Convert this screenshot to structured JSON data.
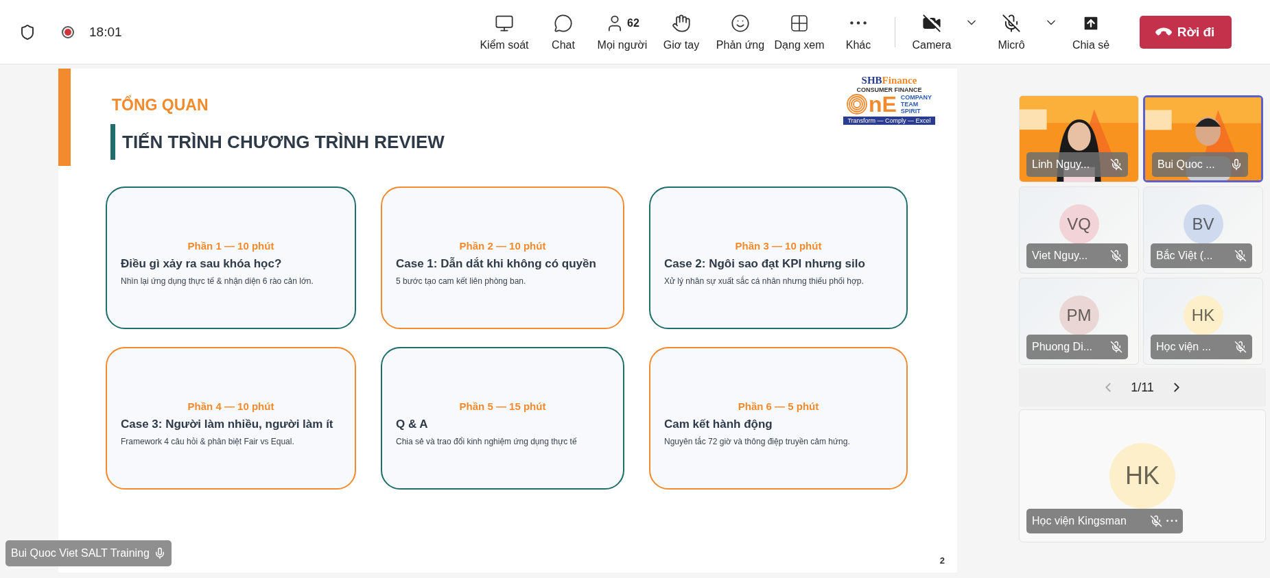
{
  "top_bar": {
    "time": "18:01",
    "recording": true
  },
  "toolbar": [
    {
      "label": "Kiểm soát"
    },
    {
      "label": "Chat"
    },
    {
      "label": "Mọi người",
      "badge": "62"
    },
    {
      "label": "Giơ tay"
    },
    {
      "label": "Phản ứng"
    },
    {
      "label": "Dạng xem"
    },
    {
      "label": "Khác"
    }
  ],
  "devices": [
    {
      "label": "Camera",
      "on": false
    },
    {
      "label": "Micrô",
      "on": false
    }
  ],
  "share": {
    "label": "Chia sẻ"
  },
  "leave_button": {
    "label": "Rời đi"
  },
  "slide": {
    "section": "TỔNG QUAN",
    "title": "TIẾN TRÌNH CHƯƠNG TRÌNH REVIEW",
    "page": "2",
    "logo": {
      "brand_prefix": "SHB",
      "brand_suffix": "Finance",
      "subtitle": "CONSUMER FINANCE",
      "letters": "nE",
      "words": [
        "COMPANY",
        "TEAM",
        "SPIRIT"
      ],
      "tagline": "Transform — Comply — Excel"
    },
    "cards": [
      {
        "label": "Phần 1 — 10 phút",
        "title": "Điều gì xảy ra sau khóa học?",
        "text": "Nhìn lại ứng dụng thực tế & nhận diện 6 rào cản lớn.",
        "color": "#1f6e6a"
      },
      {
        "label": "Phần 2 — 10 phút",
        "title": "Case 1: Dẫn dắt khi không có quyền",
        "text": "5 bước tạo cam kết liên phòng ban.",
        "color": "#f28a2e"
      },
      {
        "label": "Phần 3 — 10 phút",
        "title": "Case 2: Ngôi sao đạt KPI nhưng silo",
        "text": "Xử lý nhân sự xuất sắc cá nhân nhưng thiếu phối hợp.",
        "color": "#1f6e6a"
      },
      {
        "label": "Phần 4 — 10 phút",
        "title": "Case 3: Người làm nhiều, người làm ít",
        "text": "Framework 4 câu hỏi & phân biệt Fair vs Equal.",
        "color": "#f28a2e"
      },
      {
        "label": "Phần 5 — 15 phút",
        "title": "Q & A",
        "text": "Chia sẻ và trao đổi kinh nghiệm ứng dụng thực tế",
        "color": "#1f6e6a"
      },
      {
        "label": "Phần 6 — 5 phút",
        "title": "Cam kết hành động",
        "text": "Nguyên tắc 72 giờ và thông điệp truyền cảm hứng.",
        "color": "#f28a2e"
      }
    ]
  },
  "participants": [
    {
      "kind": "video",
      "name": "Linh Nguy...",
      "muted": true,
      "selected": false
    },
    {
      "kind": "video",
      "name": "Bui Quoc ...",
      "muted": false,
      "selected": true
    },
    {
      "kind": "avatar",
      "initials": "VQ",
      "name": "Viet Nguy...",
      "muted": true,
      "selected": false,
      "color": "#f2d3d7"
    },
    {
      "kind": "avatar",
      "initials": "BV",
      "name": "Bắc Việt (...",
      "muted": true,
      "selected": false,
      "color": "#cfdaee"
    },
    {
      "kind": "avatar",
      "initials": "PM",
      "name": "Phuong Di...",
      "muted": true,
      "selected": false,
      "color": "#ead7d5"
    },
    {
      "kind": "avatar",
      "initials": "HK",
      "name": "Học viện ...",
      "muted": true,
      "selected": false,
      "color": "#fcefca"
    }
  ],
  "pagination": {
    "label": "1/11",
    "prev_enabled": false
  },
  "self_tile": {
    "initials": "HK",
    "name": "Học viện Kingsman",
    "muted": true,
    "color": "#fcefca"
  },
  "speaker_label": {
    "name": "Bui Quoc Viet SALT Training",
    "muted": false
  }
}
